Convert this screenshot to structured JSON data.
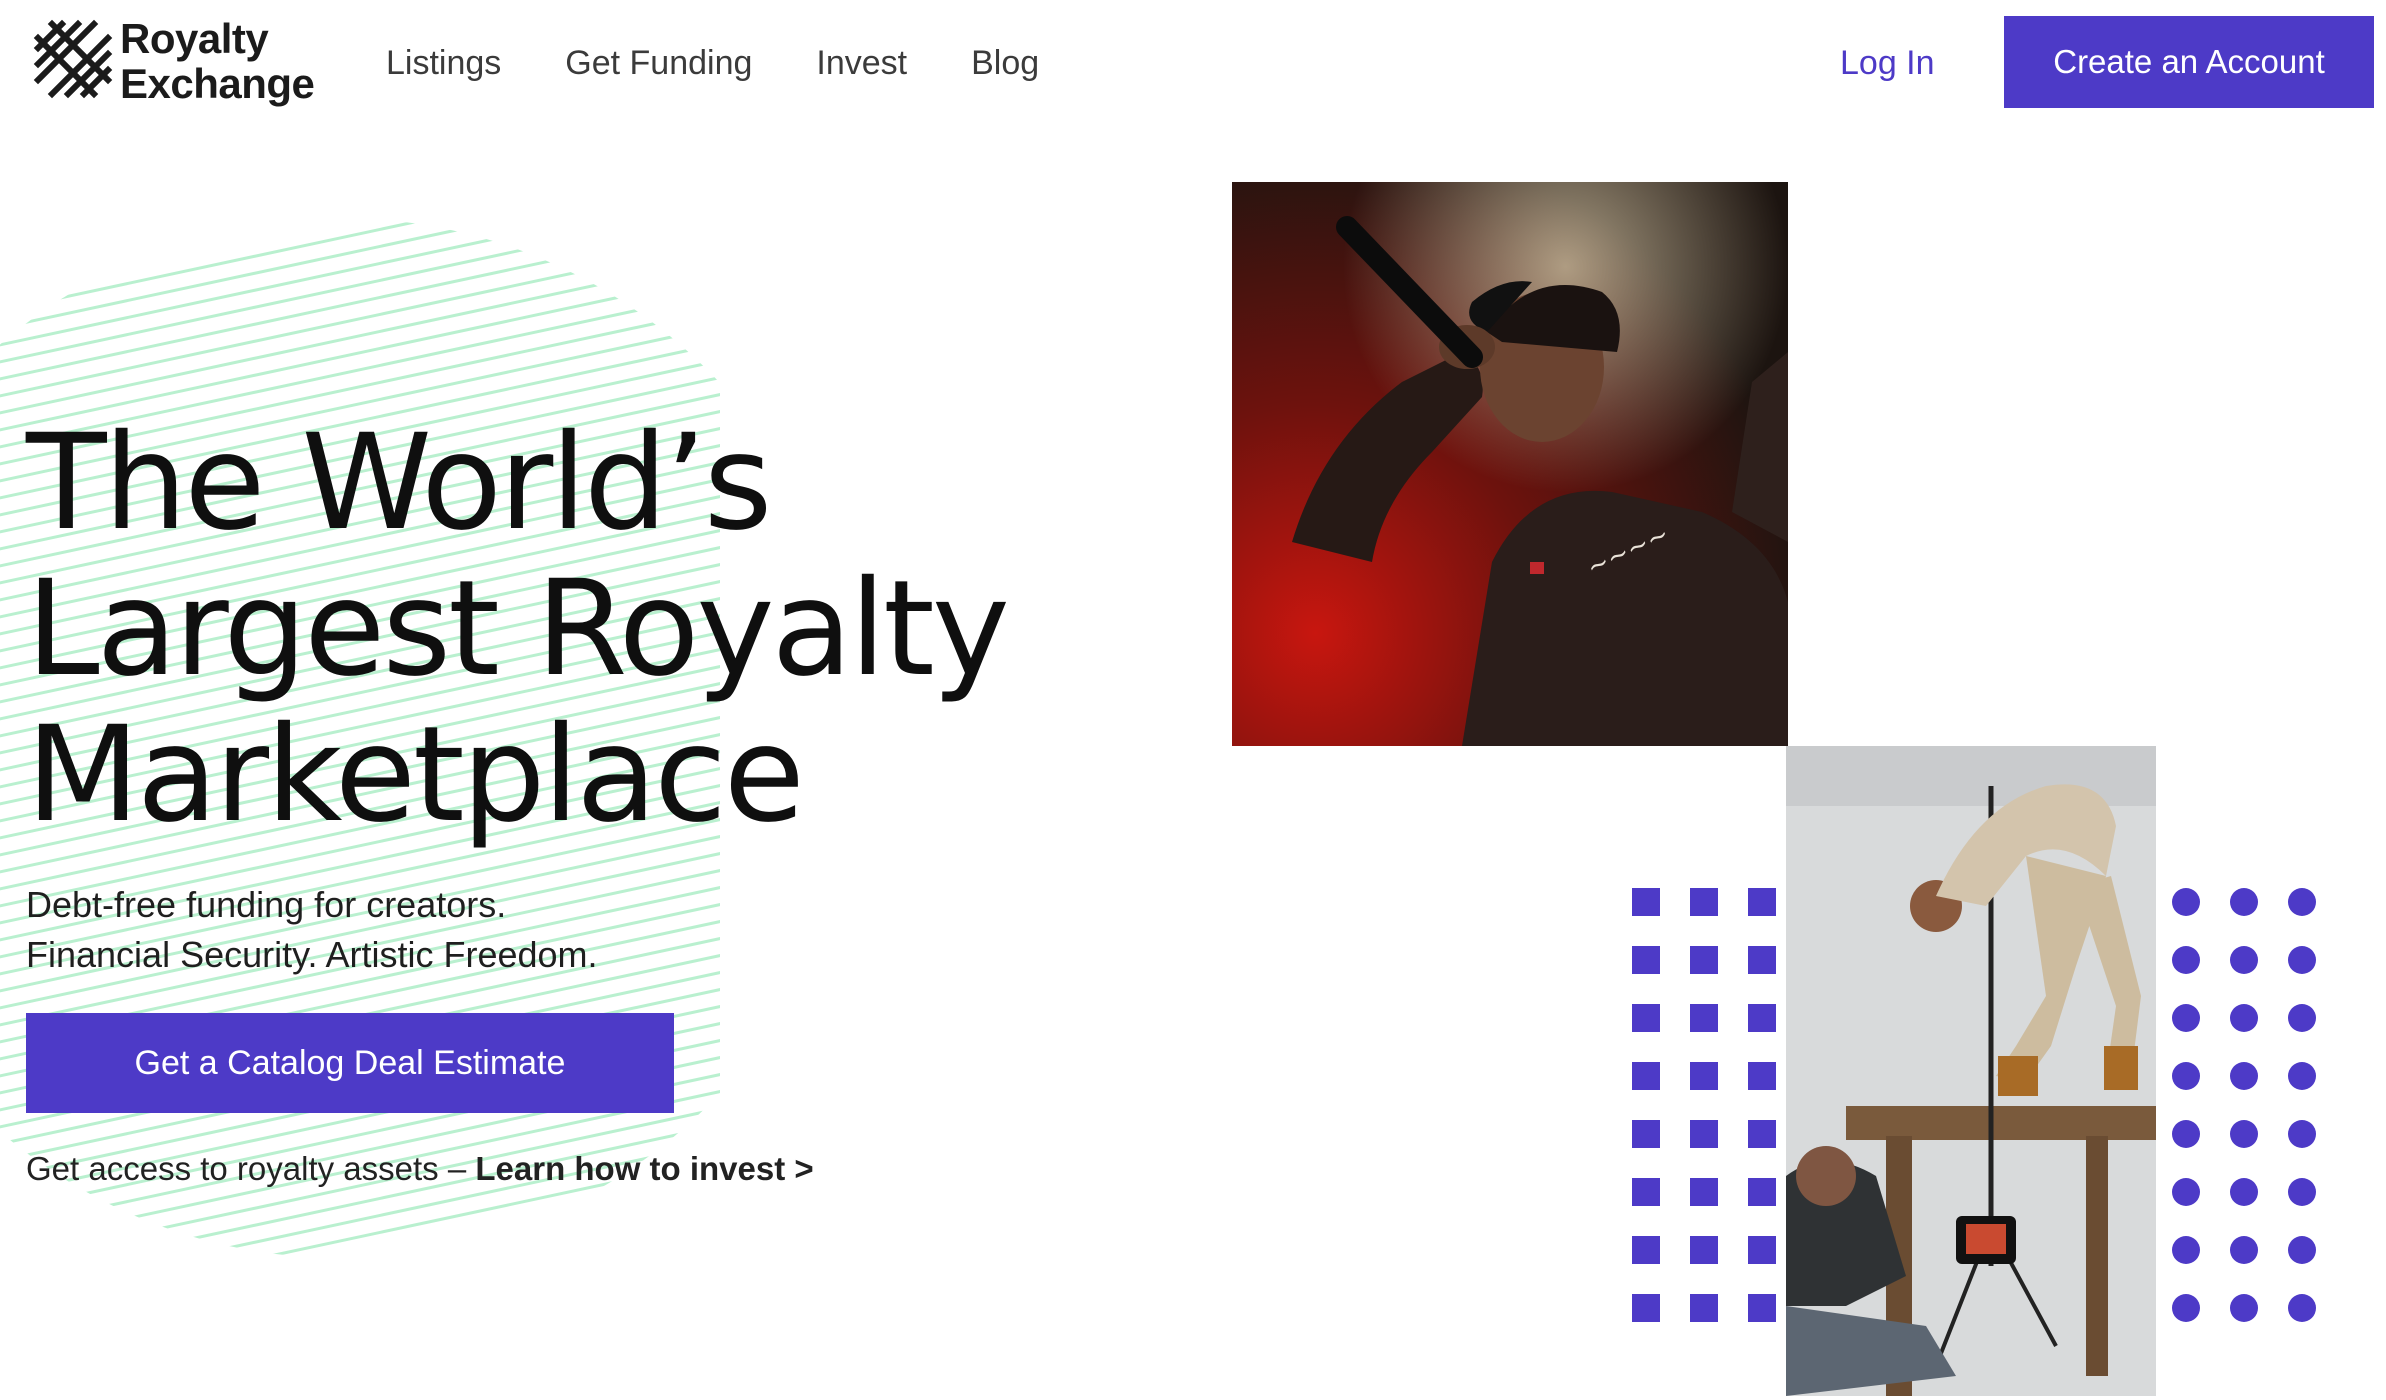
{
  "brand": {
    "line1": "Royalty",
    "line2": "Exchange"
  },
  "nav": [
    "Listings",
    "Get Funding",
    "Invest",
    "Blog"
  ],
  "header": {
    "login": "Log In",
    "create_account": "Create an Account"
  },
  "hero": {
    "title_lines": [
      "The World’s",
      "Largest Royalty",
      "Marketplace"
    ],
    "sub_lines": [
      "Debt-free funding for creators.",
      "Financial Security. Artistic Freedom."
    ],
    "cta": "Get a Catalog Deal Estimate",
    "invest_prefix": "Get access to royalty assets – ",
    "invest_link": "Learn how to invest >"
  },
  "colors": {
    "accent": "#4d3ac7",
    "stripe": "#b9f0cf",
    "text": "#1a1a1a"
  }
}
